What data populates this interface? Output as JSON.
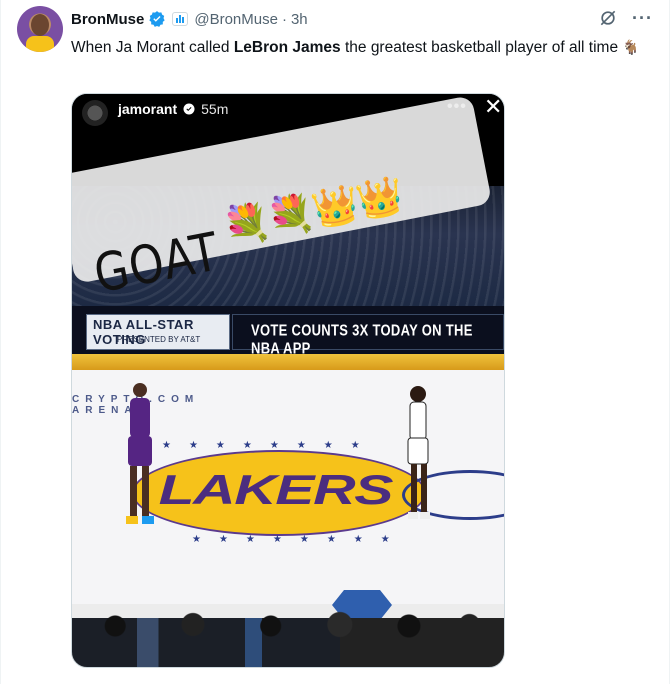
{
  "tweet": {
    "author_name": "BronMuse",
    "handle": "@BronMuse",
    "separator": "·",
    "time": "3h",
    "text_before": "When Ja Morant called ",
    "text_bold": "LeBron James",
    "text_after": " the greatest basketball player of all time ",
    "emoji": "🐐",
    "more_label": "···"
  },
  "media": {
    "story_user": "jamorant",
    "story_time": "55m",
    "story_more": "•••",
    "story_close": "✕",
    "sticker_text": "GOAT",
    "sticker_emojis": "💐💐👑👑",
    "banner_left_title": "NBA ALL-STAR VOTING",
    "banner_left_sub": "PRESENTED BY AT&T",
    "banner_right_text": "VOTE COUNTS 3X TODAY ON THE NBA APP",
    "court_word": "LAKERS",
    "court_text": "CRYPTO.COM ARENA"
  },
  "colors": {
    "verified": "#1d9bf0",
    "secondary_text": "#536471",
    "lakers_purple": "#4b2d7f",
    "lakers_gold": "#f6c21a"
  },
  "icons": {
    "verified": "verified-badge-icon",
    "affiliate": "affiliate-badge-icon",
    "grok": "grok-icon",
    "more": "more-icon"
  }
}
